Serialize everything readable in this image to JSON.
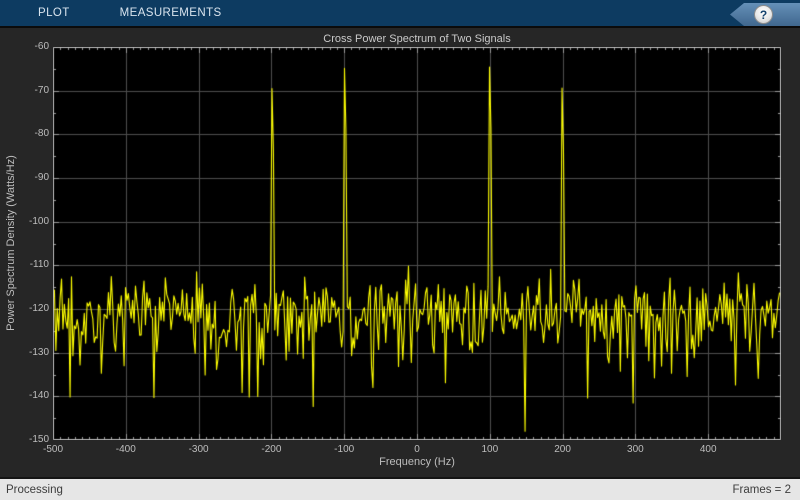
{
  "toolbar": {
    "tabs": [
      {
        "label": "PLOT"
      },
      {
        "label": "MEASUREMENTS"
      }
    ],
    "help_button_label": "?",
    "bg_color": "#0d3b61"
  },
  "status_bar": {
    "left_text": "Processing",
    "right_text": "Frames = 2",
    "bg_color": "#e6e6e6"
  },
  "chart_data": {
    "type": "line",
    "title": "Cross Power Spectrum of Two Signals",
    "xlabel": "Frequency (Hz)",
    "ylabel": "Power Spectrum Density (Watts/Hz)",
    "xlim": [
      -500,
      500
    ],
    "ylim": [
      -150,
      -60
    ],
    "x_major_ticks": [
      -500,
      -400,
      -300,
      -200,
      -100,
      0,
      100,
      200,
      300,
      400
    ],
    "x_minor_step": 10,
    "y_major_ticks": [
      -150,
      -140,
      -130,
      -120,
      -110,
      -100,
      -90,
      -80,
      -70,
      -60
    ],
    "y_minor_step": 5,
    "grid": true,
    "legend": "none",
    "line_color": "#ffff00",
    "plot_background": "#000000",
    "grid_color": "#4e4e4e",
    "axis_color": "#b2b2b2",
    "tick_color": "#9a9a9a",
    "text_color": "#bdbdbd",
    "peaks": [
      {
        "frequency_hz": -200,
        "level_db": -69.5
      },
      {
        "frequency_hz": -100,
        "level_db": -64.9
      },
      {
        "frequency_hz": 100,
        "level_db": -64.6
      },
      {
        "frequency_hz": 200,
        "level_db": -69.4
      }
    ],
    "noise_floor": {
      "mean_db": -121,
      "typical_band_db": [
        -135,
        -110
      ],
      "min_db": -148,
      "points": 512,
      "seed": 911,
      "spectral_averages": 2
    }
  }
}
